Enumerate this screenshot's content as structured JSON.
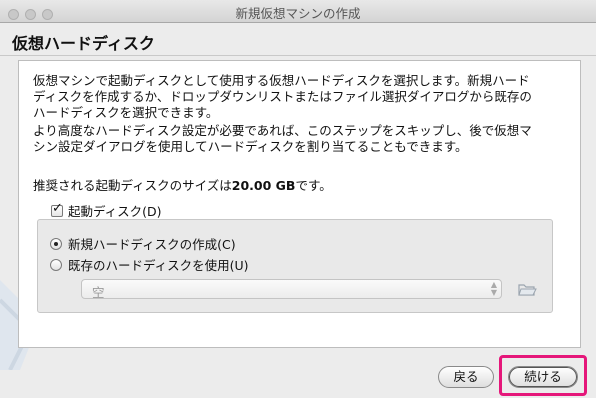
{
  "window": {
    "title": "新規仮想マシンの作成"
  },
  "heading": "仮想ハードディスク",
  "description": {
    "p1_line1": "仮想マシンで起動ディスクとして使用する仮想ハードディスクを選択します。新規ハード",
    "p1_line2": "ディスクを作成するか、ドロップダウンリストまたはファイル選択ダイアログから既存の",
    "p1_line3": "ハードディスクを選択できます。",
    "p2_line1": "より高度なハードディスク設定が必要であれば、このステップをスキップし、後で仮想マ",
    "p2_line2": "シン設定ダイアログを使用してハードディスクを割り当てることもできます。",
    "p3_prefix": "推奨される起動ディスクのサイズは",
    "p3_size": "20.00 GB",
    "p3_suffix": "です。"
  },
  "boot_disk": {
    "label": "起動ディスク(D)",
    "checked": true
  },
  "options": {
    "create_new": {
      "label": "新規ハードディスクの作成(C)",
      "selected": true
    },
    "use_existing": {
      "label": "既存のハードディスクを使用(U)",
      "selected": false
    }
  },
  "existing_disk_select": {
    "value": "空",
    "enabled": false
  },
  "buttons": {
    "back": "戻る",
    "continue": "続ける"
  },
  "colors": {
    "highlight": "#e5177a"
  },
  "icons": {
    "folder": "folder-open-icon",
    "select_arrows": "up-down-arrows-icon"
  }
}
